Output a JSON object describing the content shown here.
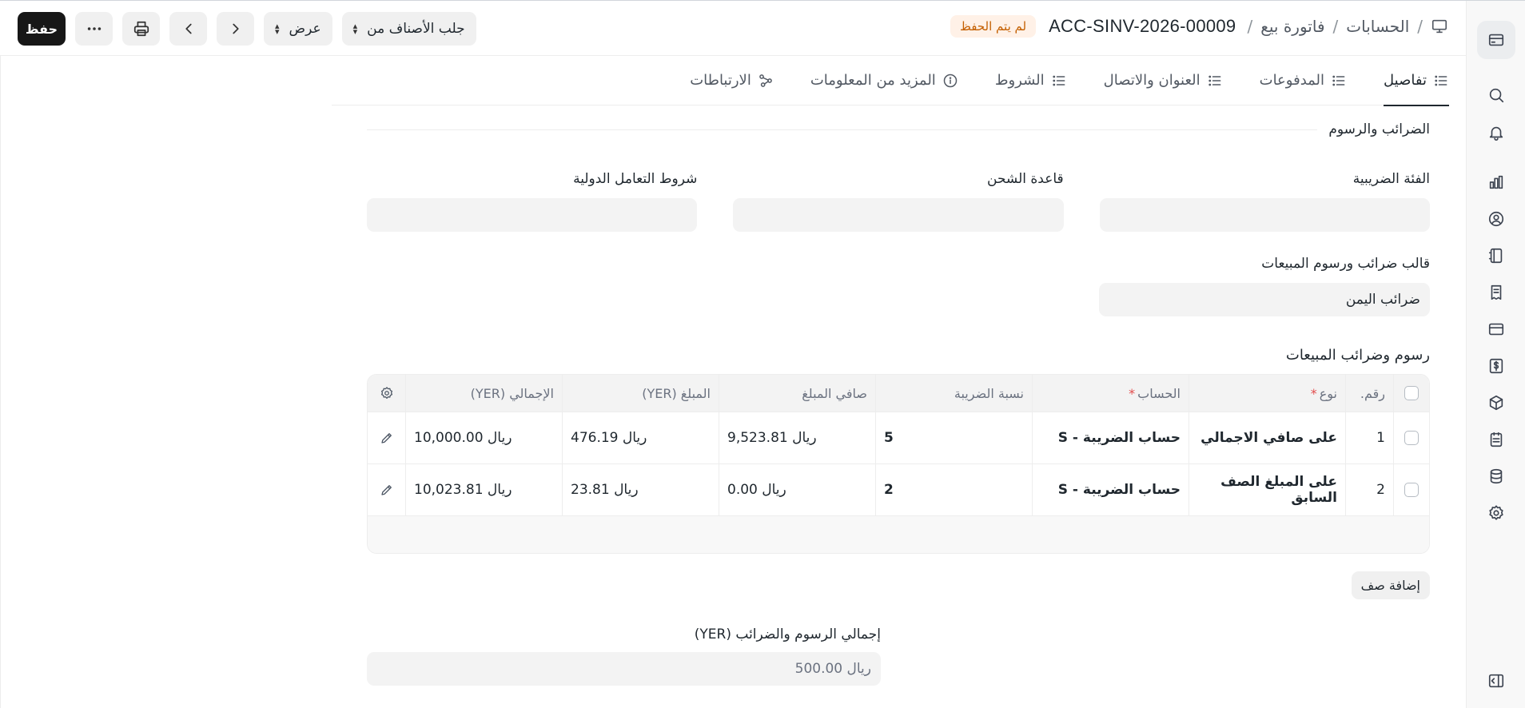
{
  "breadcrumb": {
    "root": "الحسابات",
    "doctype": "فاتورة بيع",
    "doc_id": "ACC-SINV-2026-00009",
    "status_badge": "لم يتم الحفظ"
  },
  "actions": {
    "get_items_label": "جلب الأصناف من",
    "view_label": "عرض",
    "save_label": "حفظ"
  },
  "tabs": [
    {
      "label": "تفاصيل",
      "active": true
    },
    {
      "label": "المدفوعات"
    },
    {
      "label": "العنوان والاتصال"
    },
    {
      "label": "الشروط"
    },
    {
      "label": "المزيد من المعلومات"
    },
    {
      "label": "الارتباطات"
    }
  ],
  "section": {
    "title": "الضرائب والرسوم",
    "tax_category_label": "الفئة الضريبية",
    "tax_category_value": "",
    "shipping_rule_label": "قاعدة الشحن",
    "shipping_rule_value": "",
    "incoterm_label": "شروط التعامل الدولية",
    "incoterm_value": "",
    "template_label": "قالب ضرائب ورسوم المبيعات",
    "template_value": "ضرائب اليمن"
  },
  "taxes_table": {
    "title": "رسوم وضرائب المبيعات",
    "headers": {
      "no": "رقم.",
      "type": "نوع",
      "account": "الحساب",
      "rate": "نسبة الضريبة",
      "net": "صافي المبلغ",
      "amount": "المبلغ (YER)",
      "total": "الإجمالي (YER)"
    },
    "rows": [
      {
        "no": "1",
        "type": "على صافي الاجمالي",
        "account": "حساب الضريبة - S",
        "rate": "5",
        "net": "ريال 9,523.81",
        "amount": "ريال 476.19",
        "total": "ريال 10,000.00"
      },
      {
        "no": "2",
        "type": "على المبلغ الصف السابق",
        "account": "حساب الضريبة - S",
        "rate": "2",
        "net": "ريال 0.00",
        "amount": "ريال 23.81",
        "total": "ريال 10,023.81"
      }
    ],
    "add_row_label": "إضافة صف"
  },
  "total_taxes": {
    "label": "إجمالي الرسوم والضرائب (YER)",
    "value": "ريال 500.00"
  }
}
